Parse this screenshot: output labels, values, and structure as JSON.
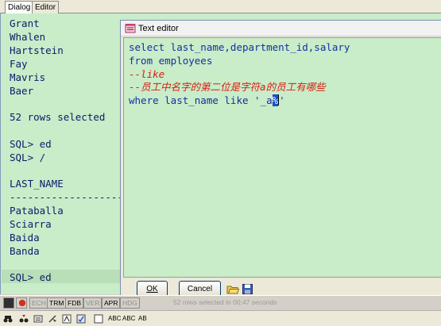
{
  "tabs": [
    {
      "label": "Dialog",
      "active": true
    },
    {
      "label": "Editor",
      "active": false
    }
  ],
  "console": {
    "lines": [
      "Grant",
      "Whalen",
      "Hartstein",
      "Fay",
      "Mavris",
      "Baer",
      "",
      "52 rows selected",
      "",
      "SQL> ed",
      "SQL> /",
      "",
      "LAST_NAME",
      "------------------------",
      "Pataballa",
      "Sciarra",
      "Baida",
      "Banda",
      "",
      "SQL> ed"
    ]
  },
  "editor": {
    "title": "Text editor",
    "lines": [
      "select last_name,department_id,salary",
      "from employees",
      "--like",
      "--员工中名字的第二位是字符a的员工有哪些"
    ],
    "last_line_before": "where last_name like '_a",
    "last_line_selected": "%",
    "last_line_after": "'",
    "ok_label": "OK",
    "cancel_label": "Cancel",
    "icons": [
      "open-folder-icon",
      "save-disk-icon"
    ]
  },
  "statusbar": {
    "items": [
      "ECH",
      "TRM",
      "FDB",
      "VER",
      "APR",
      "HDG"
    ],
    "message": "52 rows selected in 00:47 seconds"
  },
  "toolbar": {
    "items": [
      "ABC",
      "ABC",
      "AB"
    ],
    "icons": [
      "binoculars-icon",
      "find-next-icon",
      "replace-icon",
      "clear-icon",
      "font-icon",
      "spell-check-icon",
      "case-icon"
    ]
  },
  "colors": {
    "console_bg": "#c9ecc9",
    "console_text": "#0b1c6b",
    "comment_text": "#d42010",
    "code_text": "#1230a0",
    "selection": "#1450d0"
  }
}
